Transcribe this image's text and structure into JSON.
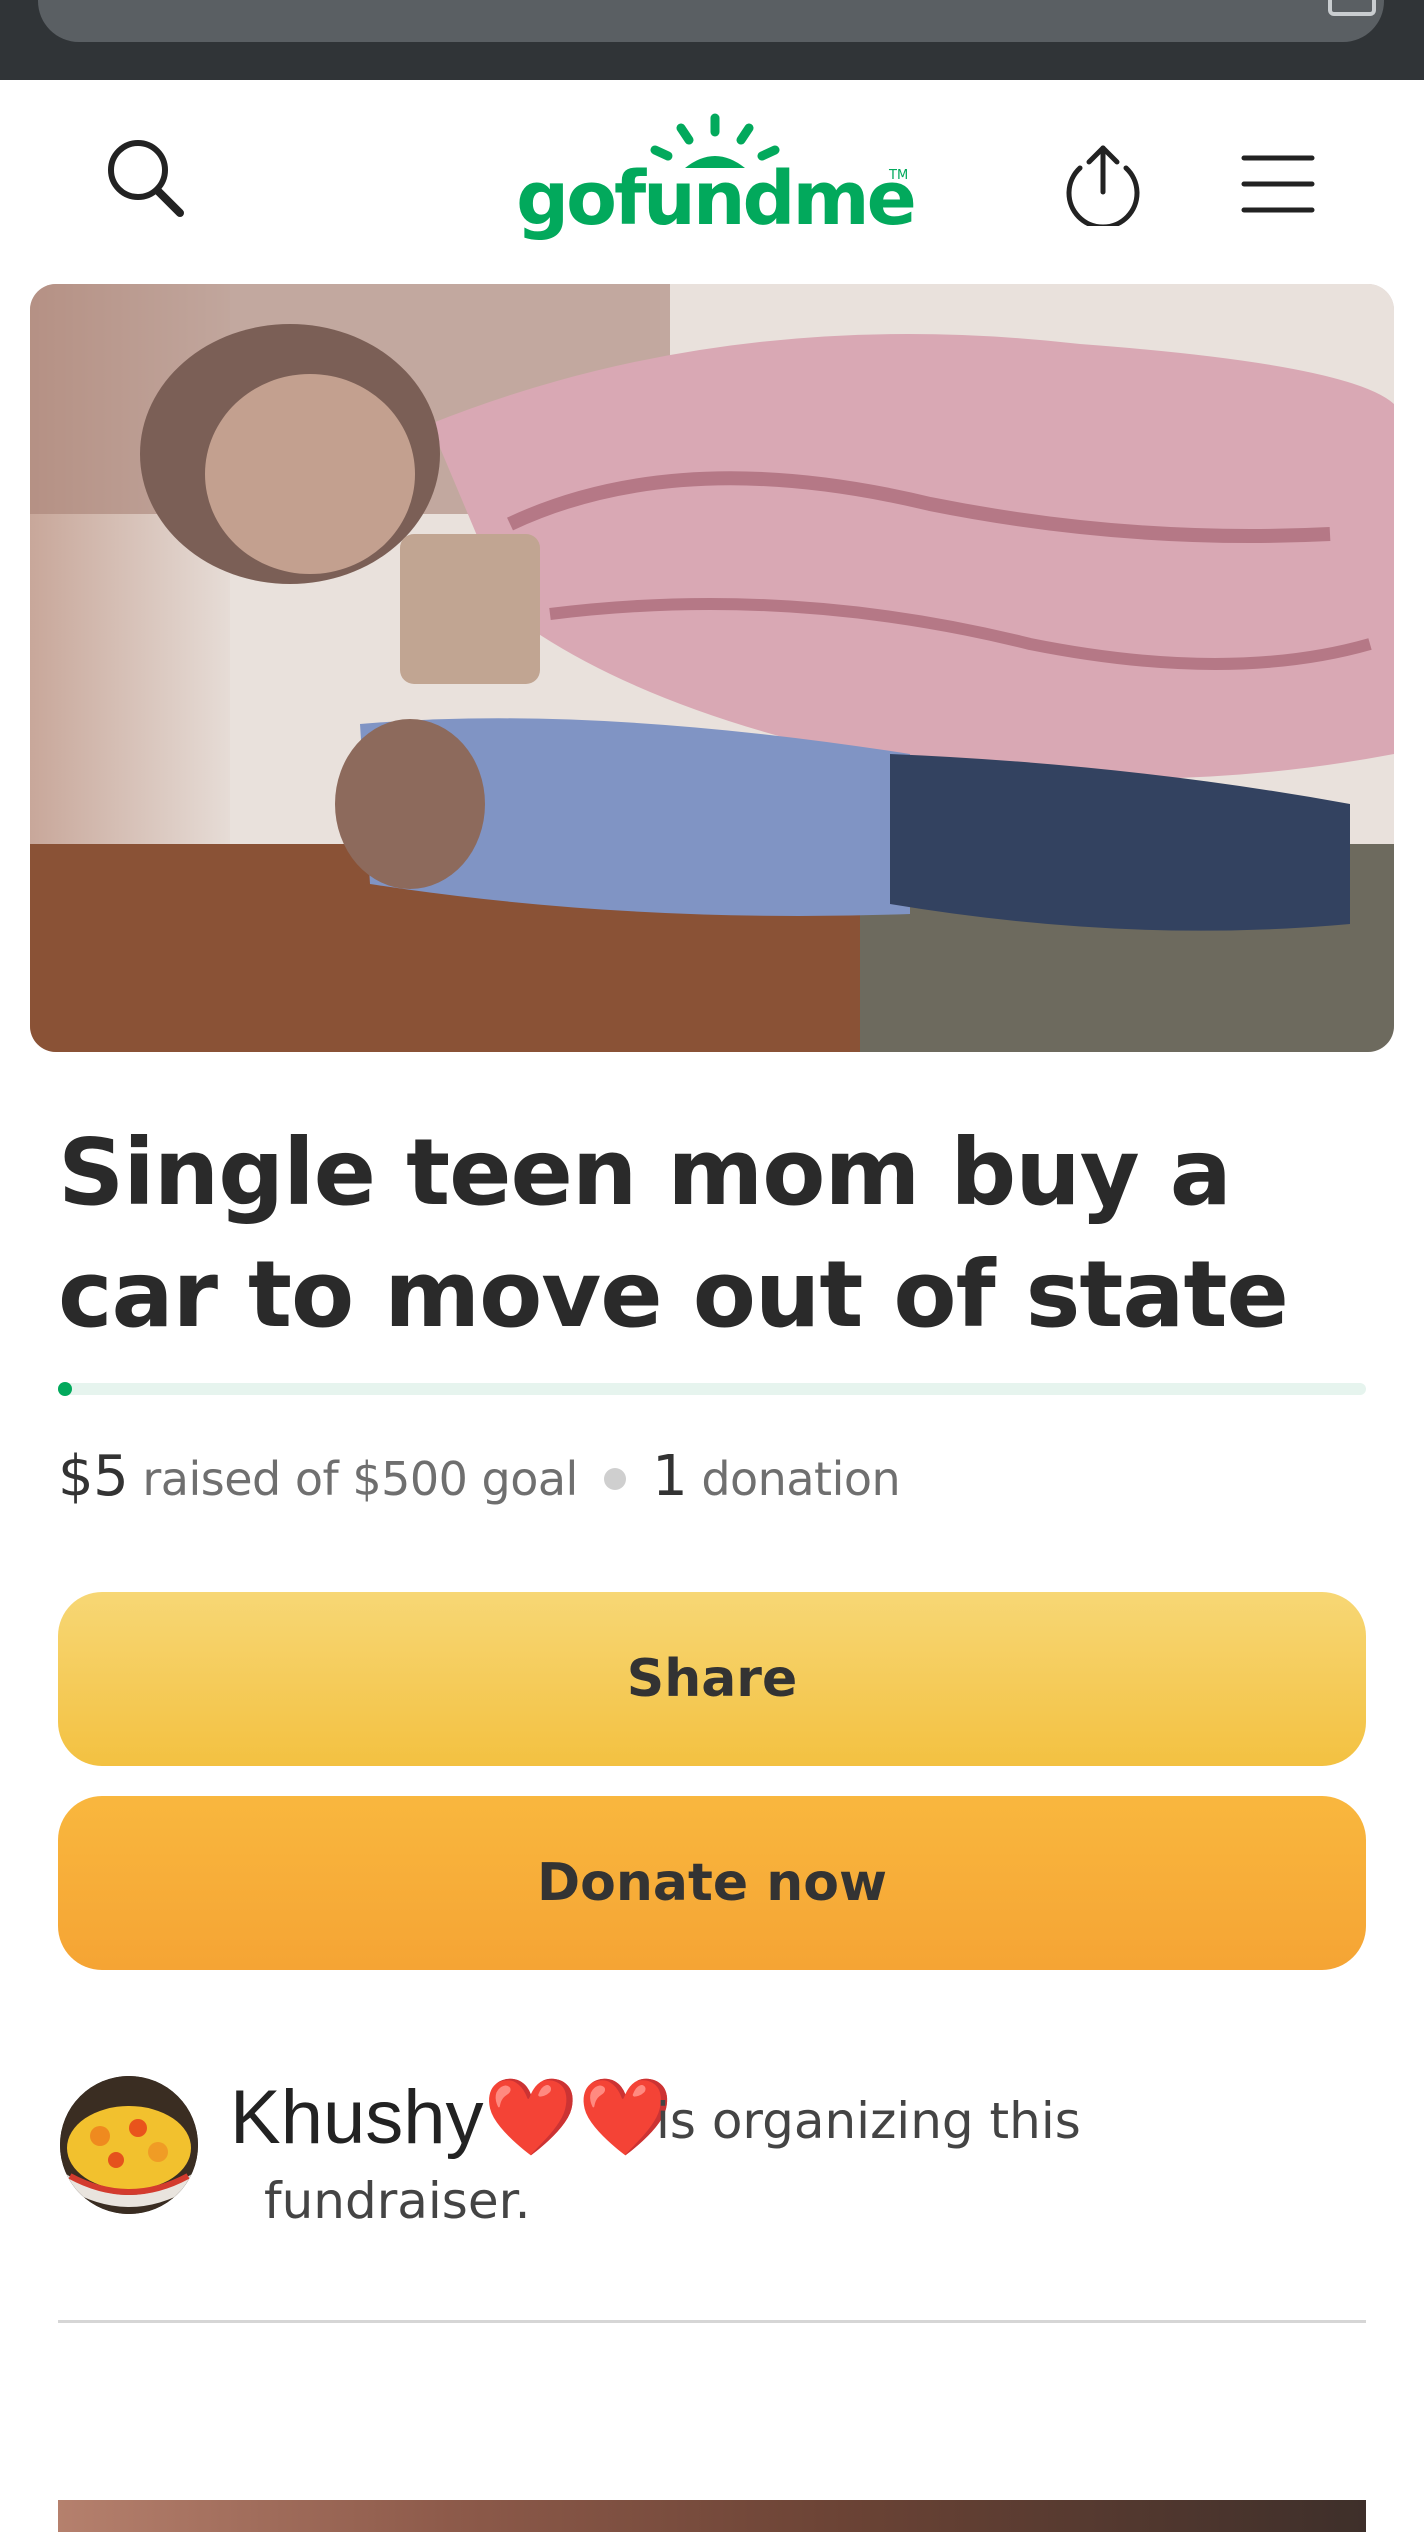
{
  "browser": {},
  "header": {
    "logo_text": "gofundme",
    "logo_tm": "TM",
    "brand_color": "#02a95c"
  },
  "icons": {
    "search": "search-icon",
    "share": "upload-share-icon",
    "menu": "hamburger-menu-icon"
  },
  "fundraiser": {
    "title": "Single teen mom buy a car to move out of state",
    "progress_fraction": 0.01,
    "raised": "$5",
    "raised_label": "raised of $500 goal",
    "donation_count": "1",
    "donation_label": "donation"
  },
  "buttons": {
    "share_label": "Share",
    "donate_label": "Donate now",
    "share_color": "#f5c84f",
    "donate_color": "#f7ab38"
  },
  "organizer": {
    "name": "Khushy❤️❤️",
    "text_line1": "is organizing this",
    "text_line2": "fundraiser."
  }
}
